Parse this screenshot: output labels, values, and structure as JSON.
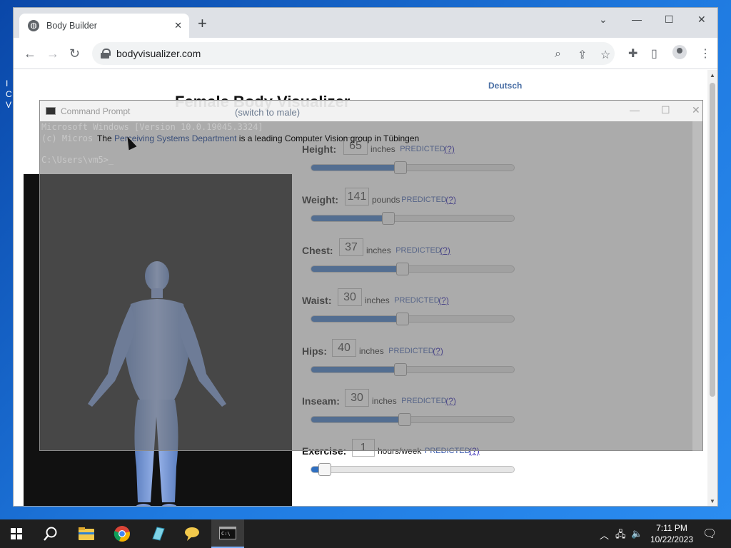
{
  "desktop": {
    "edge_lines": [
      "I",
      "C",
      "V"
    ]
  },
  "browser": {
    "tab_title": "Body Builder",
    "tab_close": "✕",
    "new_tab": "+",
    "url": "bodyvisualizer.com",
    "window_controls": {
      "chevron": "⌄",
      "minimize": "—",
      "maximize": "☐",
      "close": "✕"
    },
    "nav": {
      "back": "←",
      "forward": "→",
      "reload": "↻"
    },
    "toolbar_icons": {
      "zoom": "⌕",
      "share": "⇪",
      "star": "☆",
      "extensions": "✚",
      "sidebar": "▯",
      "menu": "⋮"
    }
  },
  "page": {
    "language_link": "Deutsch",
    "title": "Female Body Visualizer",
    "switch_link": "(switch to male)",
    "intro_prefix": "The",
    "intro_link": "Perceiving Systems Department",
    "intro_suffix": "is a leading Computer Vision group in Tübingen",
    "predicted_label": "PREDICTED",
    "help_label": "(?)",
    "sliders": [
      {
        "label": "Height:",
        "value": "65",
        "unit": "inches",
        "fraction": 0.44
      },
      {
        "label": "Weight:",
        "value": "141",
        "unit": "pounds",
        "fraction": 0.38
      },
      {
        "label": "Chest:",
        "value": "37",
        "unit": "inches",
        "fraction": 0.45
      },
      {
        "label": "Waist:",
        "value": "30",
        "unit": "inches",
        "fraction": 0.45
      },
      {
        "label": "Hips:",
        "value": "40",
        "unit": "inches",
        "fraction": 0.44
      },
      {
        "label": "Inseam:",
        "value": "30",
        "unit": "inches",
        "fraction": 0.46
      },
      {
        "label": "Exercise:",
        "value": "1",
        "unit": "hours/week",
        "fraction": 0.07
      }
    ]
  },
  "cmd": {
    "title": "Command Prompt",
    "lines": [
      "Microsoft Windows [Version 10.0.19045.3324]",
      "(c) Micros",
      "",
      "C:\\Users\\vm5>_"
    ],
    "controls": {
      "minimize": "—",
      "maximize": "☐",
      "close": "✕"
    }
  },
  "taskbar": {
    "time": "7:11 PM",
    "date": "10/22/2023"
  },
  "colors": {
    "accent": "#2f6fc0",
    "link": "#1a0dab",
    "predicted": "#3355aa"
  }
}
